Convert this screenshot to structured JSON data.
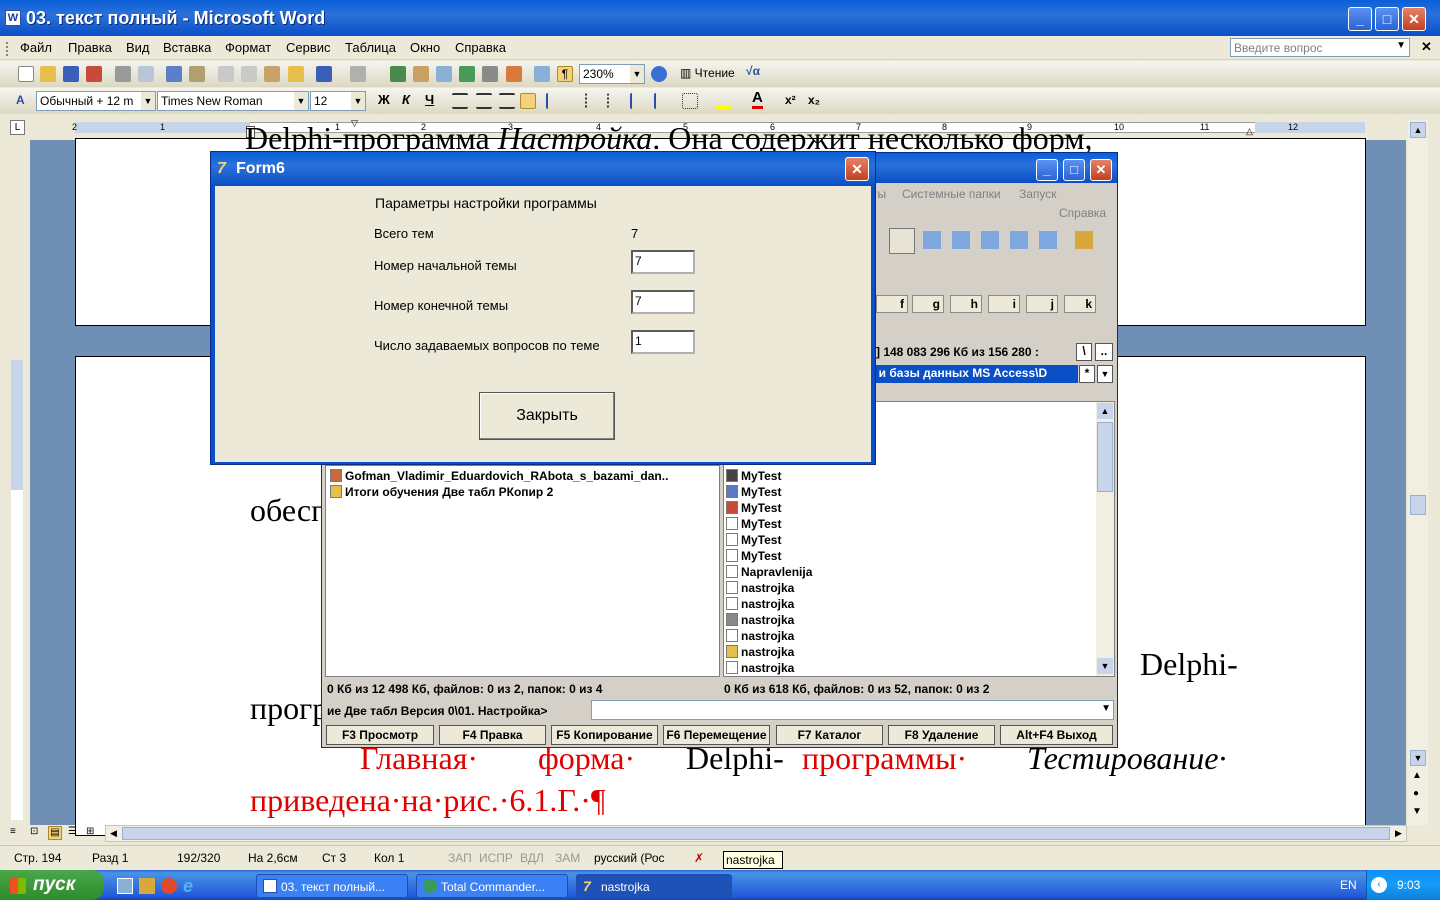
{
  "word": {
    "title": "03. текст полный - Microsoft Word",
    "menu": [
      "Файл",
      "Правка",
      "Вид",
      "Вставка",
      "Формат",
      "Сервис",
      "Таблица",
      "Окно",
      "Справка"
    ],
    "question_placeholder": "Введите вопрос",
    "zoom": "230%",
    "reading_mode": "Чтение",
    "style": "Обычный + 12 m",
    "font": "Times New Roman",
    "font_size": "12",
    "ruler_ticks": [
      "2",
      "1",
      "1",
      "2",
      "3",
      "4",
      "5",
      "6",
      "7",
      "8",
      "9",
      "10",
      "11",
      "12"
    ],
    "status": {
      "page": "Стр. 194",
      "section": "Разд 1",
      "pages": "192/320",
      "position": "На 2,6см",
      "line": "Ст 3",
      "column": "Кол 1",
      "rec": "ЗАП",
      "track": "ИСПР",
      "ext": "ВДЛ",
      "ovr": "ЗАМ",
      "language": "русский (Рос"
    },
    "doc_lines": {
      "line1_a": "Delphi-программа ",
      "line1_b": "Настройка",
      "line1_c": ". Она содержит несколько форм,",
      "line2": "обесп",
      "line3_right": "Delphi-",
      "line4": "прогр",
      "line5_a": "Главная·",
      "line5_b": "форма·",
      "line5_c": "Delphi-",
      "line5_d": "программы·",
      "line5_e": "Тестирование·",
      "line6": "приведена·на·рис.·6.1.Г.·¶"
    }
  },
  "tc": {
    "menu": [
      "ты",
      "Системные папки",
      "Запуск",
      "Справка"
    ],
    "drives": [
      "f",
      "g",
      "h",
      "i",
      "j",
      "k"
    ],
    "disk_info": "[]  148 083 296 Кб из 156 280 :",
    "path": "i и базы данных MS Access\\D",
    "left_files": [
      "Gofman_Vladimir_Eduardovich_RAbota_s_bazami_dan..",
      "Итоги обучения  Две табл РКопир 2"
    ],
    "right_files": [
      "MyTest",
      "MyTest",
      "MyTest",
      "MyTest",
      "MyTest",
      "MyTest",
      "Napravlenija",
      "nastrojka",
      "nastrojka",
      "nastrojka",
      "nastrojka",
      "nastrojka",
      "nastrojka"
    ],
    "left_status": "0 Кб из 12 498 Кб, файлов: 0 из 2, папок: 0 из 4",
    "right_status": "0 Кб из 618 Кб, файлов: 0 из 52, папок: 0 из 2",
    "cmdline": "ие  Две табл Версия 0\\01. Настройка>",
    "fkeys": [
      "F3 Просмотр",
      "F4 Правка",
      "F5 Копирование",
      "F6 Перемещение",
      "F7 Каталог",
      "F8 Удаление",
      "Alt+F4 Выход"
    ]
  },
  "form6": {
    "title": "Form6",
    "heading": "Параметры настройки программы",
    "total_label": "Всего тем",
    "total_value": "7",
    "start_label": "Номер начальной темы",
    "start_value": "7",
    "end_label": "Номер конечной темы",
    "end_value": "7",
    "questions_label": "Число задаваемых вопросов по теме",
    "questions_value": "1",
    "close_button": "Закрыть"
  },
  "taskbar": {
    "start": "пуск",
    "tasks": [
      "03. текст полный...",
      "Total Commander...",
      "nastrojka"
    ],
    "lang": "EN",
    "time": "9:03",
    "tooltip": "nastrojka"
  },
  "colors": {
    "xp_blue": "#0a5fd8",
    "close_red": "#c2401e",
    "doc_red": "#e00000",
    "start_green": "#3b9a3b"
  }
}
